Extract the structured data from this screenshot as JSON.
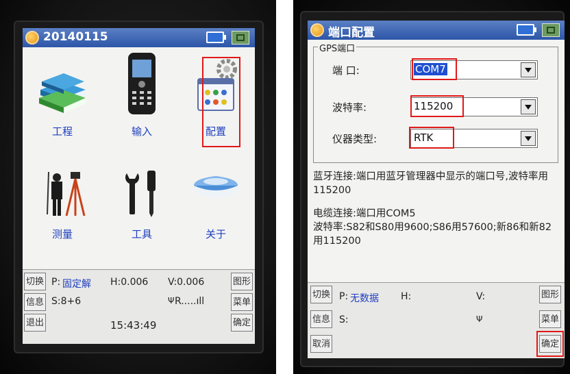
{
  "left": {
    "title": "20140115",
    "menu": [
      {
        "id": "project",
        "label": "工程",
        "icon": "books-icon"
      },
      {
        "id": "input",
        "label": "输入",
        "icon": "handheld-device-icon"
      },
      {
        "id": "config",
        "label": "配置",
        "icon": "settings-gear-icon"
      },
      {
        "id": "survey",
        "label": "测量",
        "icon": "surveyor-tripod-icon"
      },
      {
        "id": "tools",
        "label": "工具",
        "icon": "wrench-screwdriver-icon"
      },
      {
        "id": "about",
        "label": "关于",
        "icon": "gps-receiver-icon"
      }
    ],
    "status": {
      "btn_switch": "切换",
      "btn_info": "信息",
      "btn_exit": "退出",
      "btn_graph": "图形",
      "btn_menu": "菜单",
      "btn_ok": "确定",
      "p_label": "P:",
      "p_value": "固定解",
      "h_text": "H:0.006",
      "v_text": "V:0.006",
      "s_text": "S:8+6",
      "signal_text": "R.....ıll",
      "time": "15:43:49"
    }
  },
  "right": {
    "title": "端口配置",
    "group_title": "GPS端口",
    "fields": [
      {
        "label": "端    口:",
        "value": "COM7",
        "highlight": true
      },
      {
        "label": "波特率:",
        "value": "115200",
        "highlight": false
      },
      {
        "label": "仪器类型:",
        "value": "RTK",
        "highlight": false
      }
    ],
    "info_bluetooth": "蓝牙连接:端口用蓝牙管理器中显示的端口号,波特率用115200",
    "info_cable": "电缆连接:端口用COM5\n波特率:S82和S80用9600;S86用57600;新86和新82用115200",
    "status": {
      "btn_switch": "切换",
      "btn_info": "信息",
      "btn_cancel": "取消",
      "btn_graph": "图形",
      "btn_menu": "菜单",
      "btn_ok": "确定",
      "p_label": "P:",
      "p_value": "无数据",
      "h_text": "H:",
      "v_text": "V:",
      "s_text": "S:"
    }
  },
  "colors": {
    "accent_blue": "#1f3fbf",
    "highlight_red": "#e01818",
    "title_bar": "#2d56a8"
  }
}
